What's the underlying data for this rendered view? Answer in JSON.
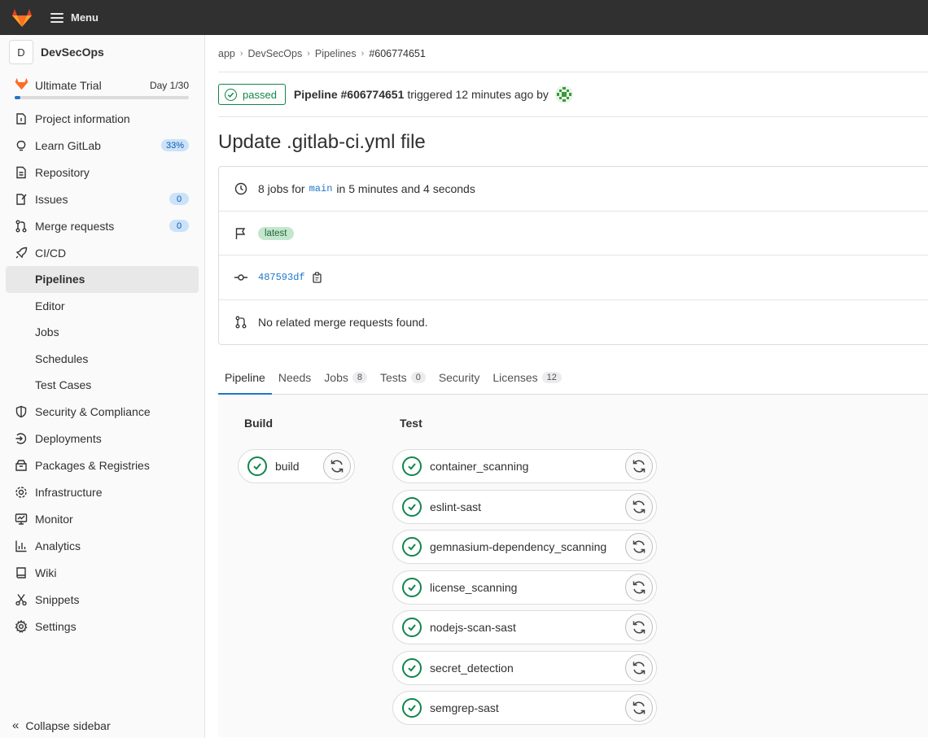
{
  "topbar": {
    "menu_label": "Menu"
  },
  "sidebar": {
    "project_initial": "D",
    "project_name": "DevSecOps",
    "trial": {
      "name": "Ultimate Trial",
      "day": "Day 1/30",
      "progress": 0.033
    },
    "items": [
      {
        "label": "Project information",
        "icon": "info-icon"
      },
      {
        "label": "Learn GitLab",
        "icon": "bulb-icon",
        "count": "33%"
      },
      {
        "label": "Repository",
        "icon": "doc-icon"
      },
      {
        "label": "Issues",
        "icon": "issues-icon",
        "count": "0"
      },
      {
        "label": "Merge requests",
        "icon": "merge-icon",
        "count": "0"
      },
      {
        "label": "CI/CD",
        "icon": "rocket-icon"
      },
      {
        "label": "Pipelines",
        "sub": true,
        "active": true
      },
      {
        "label": "Editor",
        "sub": true
      },
      {
        "label": "Jobs",
        "sub": true
      },
      {
        "label": "Schedules",
        "sub": true
      },
      {
        "label": "Test Cases",
        "sub": true
      },
      {
        "label": "Security & Compliance",
        "icon": "shield-icon"
      },
      {
        "label": "Deployments",
        "icon": "deploy-icon"
      },
      {
        "label": "Packages & Registries",
        "icon": "package-icon"
      },
      {
        "label": "Infrastructure",
        "icon": "cloud-gear-icon"
      },
      {
        "label": "Monitor",
        "icon": "monitor-icon"
      },
      {
        "label": "Analytics",
        "icon": "chart-icon"
      },
      {
        "label": "Wiki",
        "icon": "book-icon"
      },
      {
        "label": "Snippets",
        "icon": "scissors-icon"
      },
      {
        "label": "Settings",
        "icon": "gear-icon"
      }
    ],
    "collapse_label": "Collapse sidebar"
  },
  "breadcrumb": [
    "app",
    "DevSecOps",
    "Pipelines",
    "#606774651"
  ],
  "pipeline": {
    "status": "passed",
    "id_label": "Pipeline #606774651",
    "triggered": "triggered 12 minutes ago by",
    "title": "Update .gitlab-ci.yml file",
    "jobs_prefix": "8 jobs for",
    "branch": "main",
    "jobs_suffix": "in 5 minutes and 4 seconds",
    "tag": "latest",
    "commit": "487593df",
    "mr_text": "No related merge requests found."
  },
  "tabs": [
    {
      "label": "Pipeline",
      "active": true
    },
    {
      "label": "Needs"
    },
    {
      "label": "Jobs",
      "count": "8"
    },
    {
      "label": "Tests",
      "count": "0"
    },
    {
      "label": "Security"
    },
    {
      "label": "Licenses",
      "count": "12"
    }
  ],
  "stages": [
    {
      "name": "Build",
      "jobs": [
        "build"
      ]
    },
    {
      "name": "Test",
      "jobs": [
        "container_scanning",
        "eslint-sast",
        "gemnasium-dependency_scanning",
        "license_scanning",
        "nodejs-scan-sast",
        "secret_detection",
        "semgrep-sast"
      ]
    }
  ],
  "colors": {
    "success": "#108548",
    "link": "#1f75cb",
    "topbar": "#303030"
  }
}
